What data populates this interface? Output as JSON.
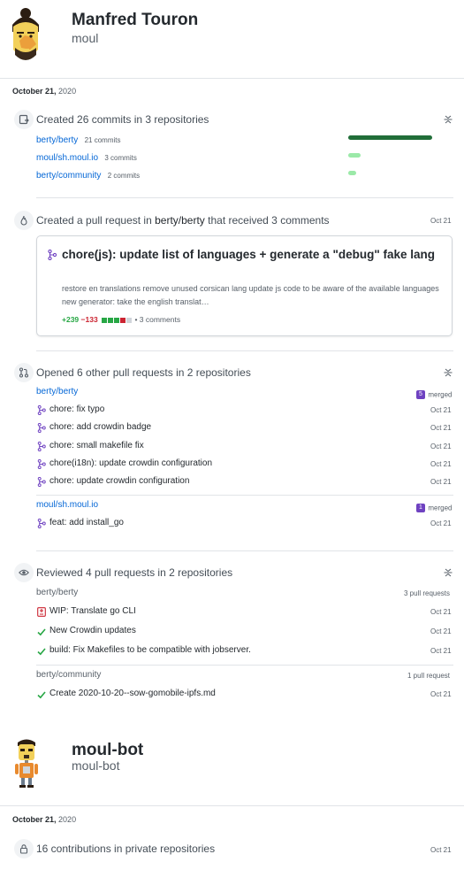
{
  "profile1": {
    "name": "Manfred Touron",
    "login": "moul",
    "date": {
      "month_day": "October 21,",
      "year": "2020"
    }
  },
  "commits": {
    "title": "Created 26 commits in 3 repositories",
    "repos": [
      {
        "name": "berty/berty",
        "count": "21 commits",
        "share": 0.81
      },
      {
        "name": "moul/sh.moul.io",
        "count": "3 commits",
        "share": 0.12
      },
      {
        "name": "berty/community",
        "count": "2 commits",
        "share": 0.08
      }
    ]
  },
  "pull_request": {
    "title_prefix": "Created a pull request in",
    "repo": "berty/berty",
    "title_suffix": "that received 3 comments",
    "date": "Oct 21",
    "card_title": "chore(js): update list of languages + generate a \"debug\" fake lang",
    "card_body": "restore en translations remove unused corsican lang update js code to be aware of the available languages new generator: take the english translat…",
    "additions": "+239",
    "deletions": "−133",
    "comments": "• 3 comments"
  },
  "opened_prs": {
    "title": "Opened 6 other pull requests in 2 repositories",
    "groups": [
      {
        "repo": "berty/berty",
        "badge": "5",
        "badge_label": "merged",
        "items": [
          {
            "title": "chore: fix typo",
            "date": "Oct 21"
          },
          {
            "title": "chore: add crowdin badge",
            "date": "Oct 21"
          },
          {
            "title": "chore: small makefile fix",
            "date": "Oct 21"
          },
          {
            "title": "chore(i18n): update crowdin configuration",
            "date": "Oct 21"
          },
          {
            "title": "chore: update crowdin configuration",
            "date": "Oct 21"
          }
        ]
      },
      {
        "repo": "moul/sh.moul.io",
        "badge": "1",
        "badge_label": "merged",
        "items": [
          {
            "title": "feat: add install_go",
            "date": "Oct 21"
          }
        ]
      }
    ]
  },
  "reviewed": {
    "title": "Reviewed 4 pull requests in 2 repositories",
    "groups": [
      {
        "repo": "berty/berty",
        "count": "3 pull requests",
        "items": [
          {
            "title": "WIP: Translate go CLI",
            "date": "Oct 21",
            "state": "changes"
          },
          {
            "title": "New Crowdin updates",
            "date": "Oct 21",
            "state": "approved"
          },
          {
            "title": "build: Fix Makefiles to be compatible with jobserver.",
            "date": "Oct 21",
            "state": "approved"
          }
        ]
      },
      {
        "repo": "berty/community",
        "count": "1 pull request",
        "items": [
          {
            "title": "Create 2020-10-20--sow-gomobile-ipfs.md",
            "date": "Oct 21",
            "state": "approved"
          }
        ]
      }
    ]
  },
  "profile2": {
    "name": "moul-bot",
    "login": "moul-bot",
    "date": {
      "month_day": "October 21,",
      "year": "2020"
    }
  },
  "private": {
    "title": "16 contributions in private repositories",
    "date": "Oct 21"
  },
  "colors": {
    "link": "#0366d6",
    "commit_bar_main": "#216e39",
    "commit_bar_light": "#9be9a8",
    "merged_purple": "#6f42c1",
    "approved_green": "#28a745",
    "changes_red": "#cb2431"
  }
}
